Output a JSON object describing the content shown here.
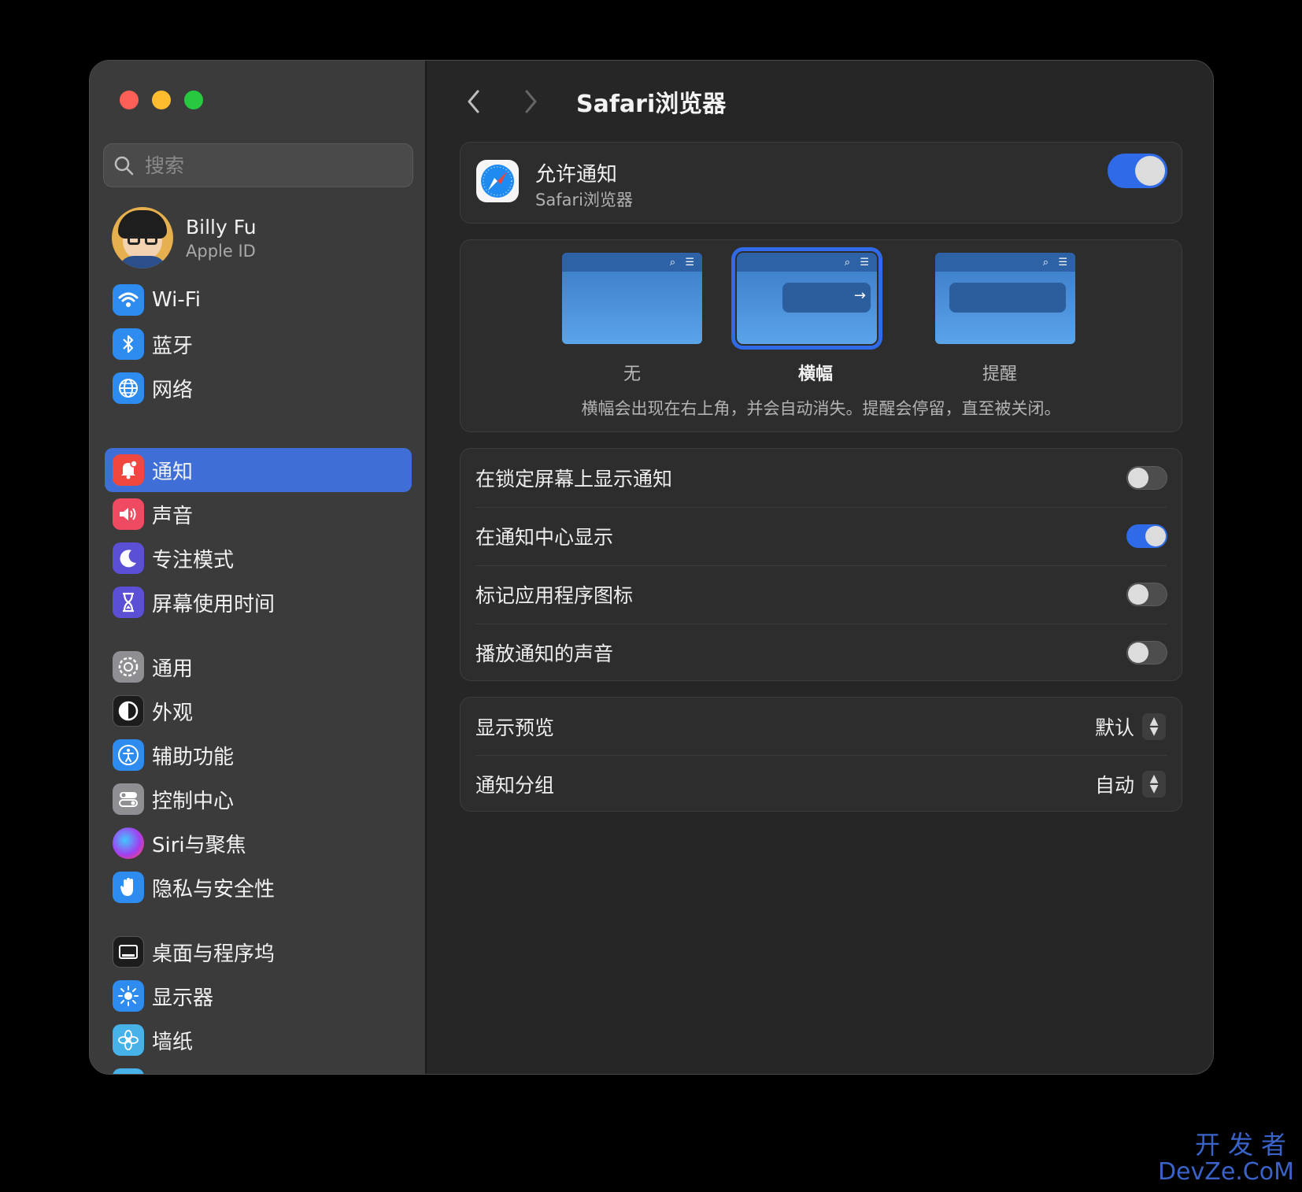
{
  "sidebar": {
    "search_placeholder": "搜索",
    "profile": {
      "name": "Billy Fu",
      "subtitle": "Apple ID"
    },
    "items": [
      {
        "label": "Wi-Fi",
        "icon": "wifi-icon",
        "color": "#2e8cf0"
      },
      {
        "label": "蓝牙",
        "icon": "bluetooth-icon",
        "color": "#2e8cf0"
      },
      {
        "label": "网络",
        "icon": "globe-icon",
        "color": "#2e8cf0"
      },
      {
        "label": "通知",
        "icon": "bell-icon",
        "color": "#f0473f",
        "active": true
      },
      {
        "label": "声音",
        "icon": "speaker-icon",
        "color": "#f04a62"
      },
      {
        "label": "专注模式",
        "icon": "moon-icon",
        "color": "#5b4fd6"
      },
      {
        "label": "屏幕使用时间",
        "icon": "hourglass-icon",
        "color": "#5b4fd6"
      },
      {
        "label": "通用",
        "icon": "gear-icon",
        "color": "#8e8e93"
      },
      {
        "label": "外观",
        "icon": "appearance-icon",
        "color": "#1c1c1c"
      },
      {
        "label": "辅助功能",
        "icon": "accessibility-icon",
        "color": "#2e8cf0"
      },
      {
        "label": "控制中心",
        "icon": "control-center-icon",
        "color": "#8e8e93"
      },
      {
        "label": "Siri与聚焦",
        "icon": "siri-icon",
        "color": "#7a3fd0"
      },
      {
        "label": "隐私与安全性",
        "icon": "hand-icon",
        "color": "#2e8cf0"
      },
      {
        "label": "桌面与程序坞",
        "icon": "dock-icon",
        "color": "#1c1c1c"
      },
      {
        "label": "显示器",
        "icon": "sun-icon",
        "color": "#2e8cf0"
      },
      {
        "label": "墙纸",
        "icon": "flower-icon",
        "color": "#47b2e8"
      }
    ]
  },
  "header": {
    "title": "Safari浏览器"
  },
  "allow": {
    "title": "允许通知",
    "subtitle": "Safari浏览器",
    "enabled": true
  },
  "alert_style": {
    "options": [
      "无",
      "横幅",
      "提醒"
    ],
    "selected": "横幅",
    "description": "横幅会出现在右上角，并会自动消失。提醒会停留，直至被关闭。"
  },
  "toggles": [
    {
      "label": "在锁定屏幕上显示通知",
      "on": false
    },
    {
      "label": "在通知中心显示",
      "on": true
    },
    {
      "label": "标记应用程序图标",
      "on": false
    },
    {
      "label": "播放通知的声音",
      "on": false
    }
  ],
  "selects": [
    {
      "label": "显示预览",
      "value": "默认"
    },
    {
      "label": "通知分组",
      "value": "自动"
    }
  ],
  "help": "?",
  "watermark": {
    "line1": "开发者",
    "line2": "DevZe.CoM"
  },
  "colors": {
    "accent": "#2f6be8",
    "sidebar_active": "#3f6fd6"
  }
}
